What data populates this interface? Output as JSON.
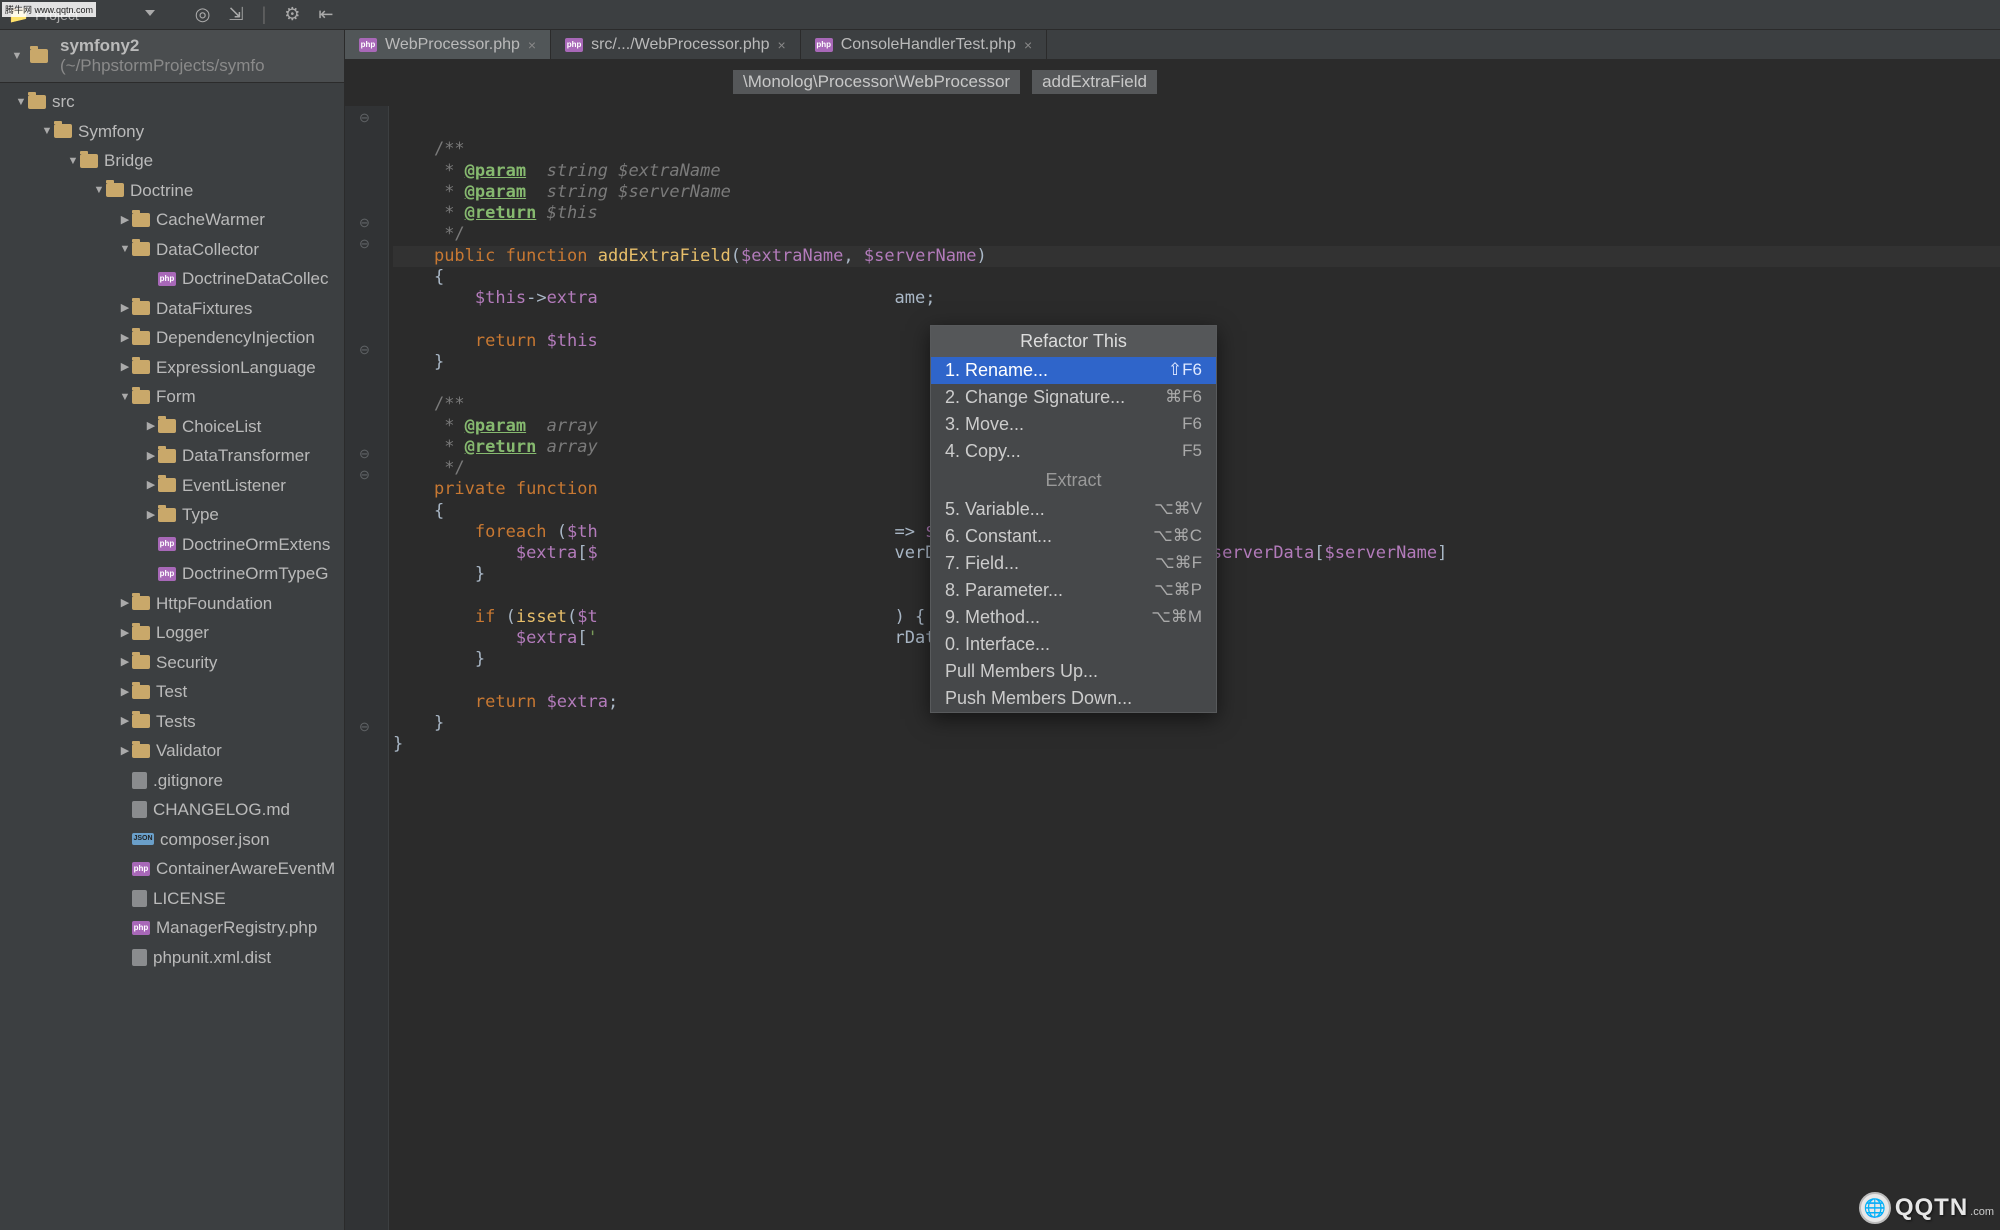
{
  "watermark_tl": "腾牛网 www.qqtn.com",
  "watermark_br_txt": "QQTN",
  "watermark_br_sub": ".com",
  "topbar": {
    "project_label": "Project"
  },
  "project_header": {
    "name": "symfony2",
    "path": "(~/PhpstormProjects/symfo"
  },
  "tree": [
    {
      "lvl": 0,
      "t": "open",
      "icon": "folder",
      "label": "src"
    },
    {
      "lvl": 1,
      "t": "open",
      "icon": "folder",
      "label": "Symfony"
    },
    {
      "lvl": 2,
      "t": "open",
      "icon": "folder",
      "label": "Bridge"
    },
    {
      "lvl": 3,
      "t": "open",
      "icon": "folder",
      "label": "Doctrine"
    },
    {
      "lvl": 4,
      "t": "closed",
      "icon": "folder",
      "label": "CacheWarmer"
    },
    {
      "lvl": 4,
      "t": "open",
      "icon": "folder",
      "label": "DataCollector"
    },
    {
      "lvl": 5,
      "t": "none",
      "icon": "php",
      "label": "DoctrineDataCollec"
    },
    {
      "lvl": 4,
      "t": "closed",
      "icon": "folder",
      "label": "DataFixtures"
    },
    {
      "lvl": 4,
      "t": "closed",
      "icon": "folder",
      "label": "DependencyInjection"
    },
    {
      "lvl": 4,
      "t": "closed",
      "icon": "folder",
      "label": "ExpressionLanguage"
    },
    {
      "lvl": 4,
      "t": "open",
      "icon": "folder",
      "label": "Form"
    },
    {
      "lvl": 5,
      "t": "closed",
      "icon": "folder",
      "label": "ChoiceList"
    },
    {
      "lvl": 5,
      "t": "closed",
      "icon": "folder",
      "label": "DataTransformer"
    },
    {
      "lvl": 5,
      "t": "closed",
      "icon": "folder",
      "label": "EventListener"
    },
    {
      "lvl": 5,
      "t": "closed",
      "icon": "folder",
      "label": "Type"
    },
    {
      "lvl": 5,
      "t": "none",
      "icon": "php",
      "label": "DoctrineOrmExtens"
    },
    {
      "lvl": 5,
      "t": "none",
      "icon": "php",
      "label": "DoctrineOrmTypeG"
    },
    {
      "lvl": 4,
      "t": "closed",
      "icon": "folder",
      "label": "HttpFoundation"
    },
    {
      "lvl": 4,
      "t": "closed",
      "icon": "folder",
      "label": "Logger"
    },
    {
      "lvl": 4,
      "t": "closed",
      "icon": "folder",
      "label": "Security"
    },
    {
      "lvl": 4,
      "t": "closed",
      "icon": "folder",
      "label": "Test"
    },
    {
      "lvl": 4,
      "t": "closed",
      "icon": "folder",
      "label": "Tests"
    },
    {
      "lvl": 4,
      "t": "closed",
      "icon": "folder",
      "label": "Validator"
    },
    {
      "lvl": 4,
      "t": "none",
      "icon": "file",
      "label": ".gitignore"
    },
    {
      "lvl": 4,
      "t": "none",
      "icon": "file",
      "label": "CHANGELOG.md"
    },
    {
      "lvl": 4,
      "t": "none",
      "icon": "json",
      "label": "composer.json"
    },
    {
      "lvl": 4,
      "t": "none",
      "icon": "php",
      "label": "ContainerAwareEventM"
    },
    {
      "lvl": 4,
      "t": "none",
      "icon": "file",
      "label": "LICENSE"
    },
    {
      "lvl": 4,
      "t": "none",
      "icon": "php",
      "label": "ManagerRegistry.php"
    },
    {
      "lvl": 4,
      "t": "none",
      "icon": "file",
      "label": "phpunit.xml.dist"
    }
  ],
  "tabs": [
    {
      "label": "WebProcessor.php",
      "active": true
    },
    {
      "label": "src/.../WebProcessor.php",
      "active": false
    },
    {
      "label": "ConsoleHandlerTest.php",
      "active": false
    }
  ],
  "breadcrumb": {
    "path": "\\Monolog\\Processor\\WebProcessor",
    "member": "addExtraField"
  },
  "popup": {
    "title": "Refactor This",
    "items": [
      {
        "n": "1",
        "label": "Rename...",
        "shortcut": "⇧F6",
        "selected": true
      },
      {
        "n": "2",
        "label": "Change Signature...",
        "shortcut": "⌘F6"
      },
      {
        "n": "3",
        "label": "Move...",
        "shortcut": "F6"
      },
      {
        "n": "4",
        "label": "Copy...",
        "shortcut": "F5"
      }
    ],
    "section": "Extract",
    "items2": [
      {
        "n": "5",
        "label": "Variable...",
        "shortcut": "⌥⌘V"
      },
      {
        "n": "6",
        "label": "Constant...",
        "shortcut": "⌥⌘C"
      },
      {
        "n": "7",
        "label": "Field...",
        "shortcut": "⌥⌘F"
      },
      {
        "n": "8",
        "label": "Parameter...",
        "shortcut": "⌥⌘P"
      },
      {
        "n": "9",
        "label": "Method...",
        "shortcut": "⌥⌘M"
      },
      {
        "n": "0",
        "label": "Interface...",
        "shortcut": ""
      }
    ],
    "footer": [
      {
        "label": "Pull Members Up..."
      },
      {
        "label": "Push Members Down..."
      }
    ]
  }
}
